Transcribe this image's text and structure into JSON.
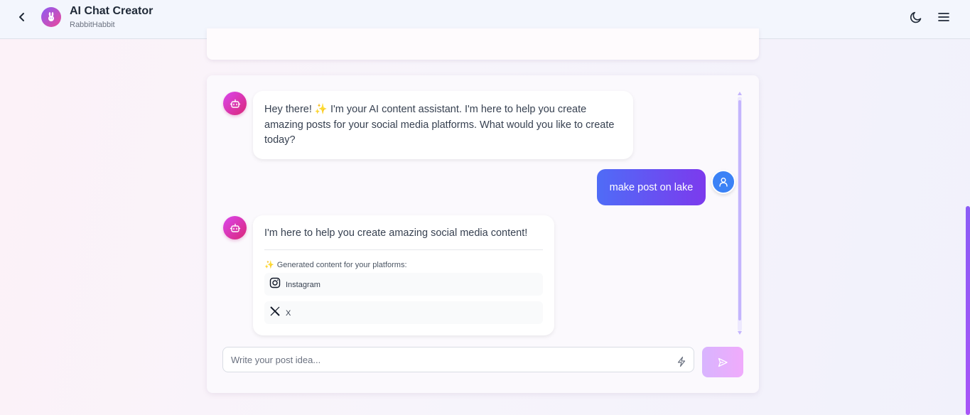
{
  "header": {
    "title": "AI Chat Creator",
    "subtitle": "RabbitHabbit",
    "icons": {
      "back": "chevron-left-icon",
      "logo": "rabbit-icon",
      "theme": "moon-icon",
      "menu": "hamburger-menu-icon"
    }
  },
  "chat": {
    "messages": [
      {
        "role": "assistant",
        "text_before": "Hey there! ",
        "emoji": "✨",
        "text_after": " I'm your AI content assistant. I'm here to help you create amazing posts for your social media platforms. What would you like to create today?"
      },
      {
        "role": "user",
        "text": "make post on lake"
      },
      {
        "role": "assistant",
        "text": "I'm here to help you create amazing social media content!",
        "generated_emoji": "✨",
        "generated_label": "Generated content for your platforms:",
        "platforms": [
          {
            "name": "Instagram",
            "icon": "instagram-icon"
          },
          {
            "name": "X",
            "icon": "x-logo-icon"
          }
        ]
      }
    ]
  },
  "composer": {
    "placeholder": "Write your post idea...",
    "value": "",
    "send_icon": "send-icon",
    "enhance_icon": "lightning-bolt-icon"
  },
  "colors": {
    "header_bg": "#f3f6fd",
    "bot_avatar": "#d946ef",
    "user_bubble_start": "#4f6cf7",
    "user_bubble_end": "#7c3aed",
    "user_avatar": "#3b82f6",
    "send_button": "#d8b4fe"
  }
}
